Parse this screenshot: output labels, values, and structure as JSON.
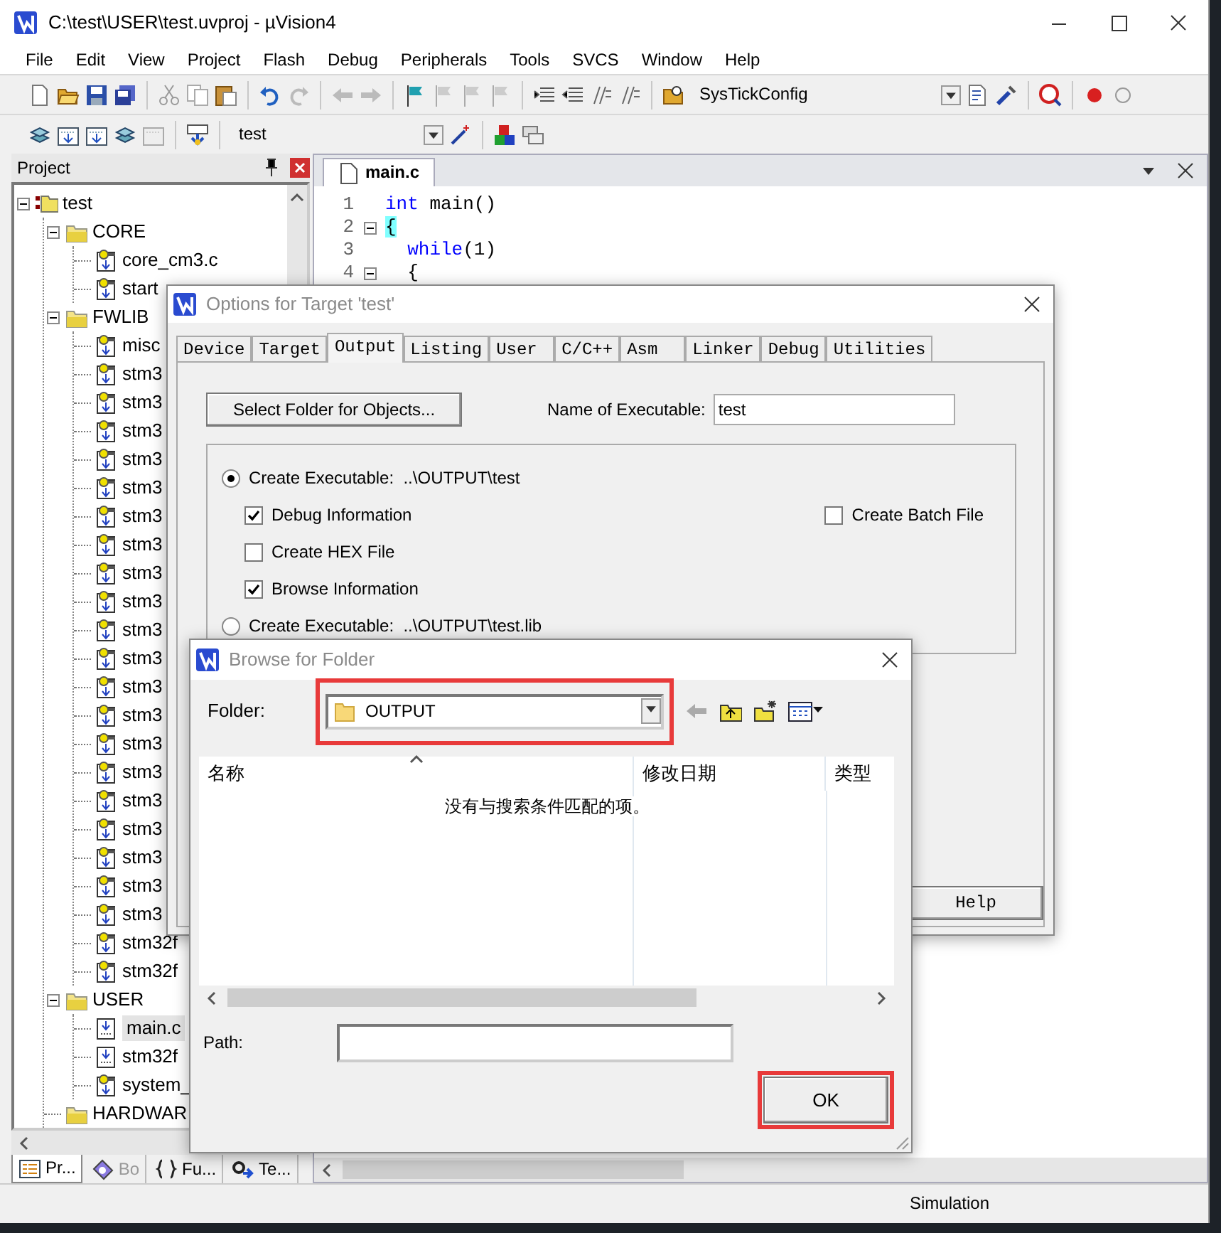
{
  "window": {
    "title": "C:\\test\\USER\\test.uvproj - µVision4"
  },
  "menu": [
    "File",
    "Edit",
    "View",
    "Project",
    "Flash",
    "Debug",
    "Peripherals",
    "Tools",
    "SVCS",
    "Window",
    "Help"
  ],
  "toolbar": {
    "function_combo": "SysTickConfig",
    "target_combo": "test"
  },
  "project_pane": {
    "title": "Project",
    "tree": [
      {
        "label": "test",
        "kind": "target",
        "expanded": true,
        "selected": false,
        "children": [
          {
            "label": "CORE",
            "kind": "group",
            "expanded": true,
            "selected": false,
            "children": [
              {
                "label": "core_cm3.c",
                "kind": "keyed-file",
                "selected": false
              },
              {
                "label": "start",
                "kind": "keyed-file",
                "selected": false
              }
            ]
          },
          {
            "label": "FWLIB",
            "kind": "group",
            "expanded": true,
            "selected": false,
            "children": [
              {
                "label": "misc",
                "kind": "keyed-file",
                "selected": false
              },
              {
                "label": "stm3",
                "kind": "keyed-file",
                "selected": false
              },
              {
                "label": "stm3",
                "kind": "keyed-file",
                "selected": false
              },
              {
                "label": "stm3",
                "kind": "keyed-file",
                "selected": false
              },
              {
                "label": "stm3",
                "kind": "keyed-file",
                "selected": false
              },
              {
                "label": "stm3",
                "kind": "keyed-file",
                "selected": false
              },
              {
                "label": "stm3",
                "kind": "keyed-file",
                "selected": false
              },
              {
                "label": "stm3",
                "kind": "keyed-file",
                "selected": false
              },
              {
                "label": "stm3",
                "kind": "keyed-file",
                "selected": false
              },
              {
                "label": "stm3",
                "kind": "keyed-file",
                "selected": false
              },
              {
                "label": "stm3",
                "kind": "keyed-file",
                "selected": false
              },
              {
                "label": "stm3",
                "kind": "keyed-file",
                "selected": false
              },
              {
                "label": "stm3",
                "kind": "keyed-file",
                "selected": false
              },
              {
                "label": "stm3",
                "kind": "keyed-file",
                "selected": false
              },
              {
                "label": "stm3",
                "kind": "keyed-file",
                "selected": false
              },
              {
                "label": "stm3",
                "kind": "keyed-file",
                "selected": false
              },
              {
                "label": "stm3",
                "kind": "keyed-file",
                "selected": false
              },
              {
                "label": "stm3",
                "kind": "keyed-file",
                "selected": false
              },
              {
                "label": "stm3",
                "kind": "keyed-file",
                "selected": false
              },
              {
                "label": "stm3",
                "kind": "keyed-file",
                "selected": false
              },
              {
                "label": "stm3",
                "kind": "keyed-file",
                "selected": false
              },
              {
                "label": "stm32f",
                "kind": "keyed-file",
                "selected": false
              },
              {
                "label": "stm32f",
                "kind": "keyed-file",
                "selected": false
              }
            ]
          },
          {
            "label": "USER",
            "kind": "group",
            "expanded": true,
            "selected": false,
            "children": [
              {
                "label": "main.c",
                "kind": "file",
                "selected": true
              },
              {
                "label": "stm32f",
                "kind": "file",
                "selected": false
              },
              {
                "label": "system_",
                "kind": "keyed-file",
                "selected": false
              }
            ]
          },
          {
            "label": "HARDWAR",
            "kind": "group",
            "selected": false
          }
        ]
      }
    ],
    "tabs": [
      {
        "label": "Pr...",
        "kind": "project",
        "selected": true
      },
      {
        "label": "Bo",
        "kind": "books",
        "selected": false
      },
      {
        "label": "Fu...",
        "kind": "functions",
        "selected": false
      },
      {
        "label": "Te...",
        "kind": "templates",
        "selected": false
      }
    ]
  },
  "editor": {
    "tab": "main.c",
    "lines": [
      {
        "number": "1",
        "fold": false,
        "code": [
          {
            "text": "int",
            "kind": "keyword"
          },
          {
            "text": " main()",
            "kind": "plain"
          }
        ]
      },
      {
        "number": "2",
        "fold": true,
        "code": [
          {
            "text": "{",
            "kind": "brace-match"
          }
        ]
      },
      {
        "number": "3",
        "fold": false,
        "code": [
          {
            "text": "  while",
            "kind": "keyword"
          },
          {
            "text": "(1)",
            "kind": "plain"
          }
        ]
      },
      {
        "number": "4",
        "fold": true,
        "code": [
          {
            "text": "  {",
            "kind": "plain"
          }
        ]
      }
    ]
  },
  "options_dialog": {
    "title": "Options for Target 'test'",
    "tabs": [
      {
        "label": "Device",
        "selected": false
      },
      {
        "label": "Target",
        "selected": false
      },
      {
        "label": "Output",
        "selected": true
      },
      {
        "label": "Listing",
        "selected": false
      },
      {
        "label": "User",
        "selected": false
      },
      {
        "label": "C/C++",
        "selected": false
      },
      {
        "label": "Asm",
        "selected": false
      },
      {
        "label": "Linker",
        "selected": false
      },
      {
        "label": "Debug",
        "selected": false
      },
      {
        "label": "Utilities",
        "selected": false
      }
    ],
    "select_folder_button": "Select Folder for Objects...",
    "executable_label": "Name of Executable:",
    "executable_value": "test",
    "options": [
      {
        "kind": "radio",
        "label": "Create Executable:  ..\\OUTPUT\\test",
        "selected": true
      },
      {
        "kind": "checkbox",
        "label": "Debug Information",
        "checked": true
      },
      {
        "kind": "checkbox",
        "label": "Create HEX File",
        "checked": false
      },
      {
        "kind": "checkbox",
        "label": "Browse Information",
        "checked": true
      },
      {
        "kind": "radio",
        "label": "Create Executable:  ..\\OUTPUT\\test.lib",
        "selected": false
      }
    ],
    "batch_file": {
      "label": "Create Batch File",
      "checked": false
    },
    "help_button": "Help"
  },
  "browse_dialog": {
    "title": "Browse for Folder",
    "folder_label": "Folder:",
    "folder_value": "OUTPUT",
    "folder_highlighted": true,
    "columns": [
      "名称",
      "修改日期",
      "类型"
    ],
    "empty_message": "没有与搜索条件匹配的项。",
    "path_label": "Path:",
    "ok_button": "OK",
    "ok_highlighted": true
  },
  "status_bar": {
    "mode": "Simulation"
  }
}
